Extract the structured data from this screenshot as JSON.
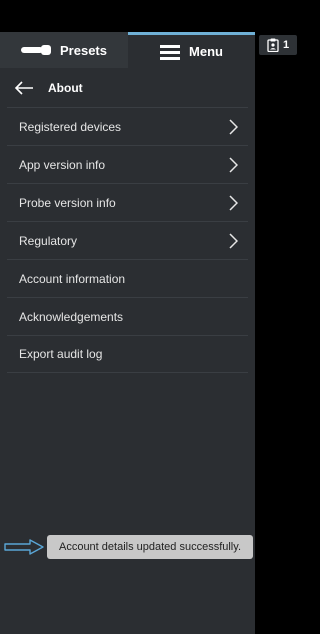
{
  "tabs": {
    "presets_label": "Presets",
    "menu_label": "Menu"
  },
  "badge": {
    "count": "1",
    "icon": "clipboard-user-icon"
  },
  "panel": {
    "title": "About",
    "items": [
      {
        "label": "Registered devices",
        "has_chevron": true
      },
      {
        "label": "App version info",
        "has_chevron": true
      },
      {
        "label": "Probe version info",
        "has_chevron": true
      },
      {
        "label": "Regulatory",
        "has_chevron": true
      },
      {
        "label": "Account information",
        "has_chevron": false
      },
      {
        "label": "Acknowledgements",
        "has_chevron": false
      },
      {
        "label": "Export audit log",
        "has_chevron": false
      }
    ]
  },
  "toast": {
    "message": "Account details updated successfully."
  },
  "colors": {
    "panel_bg": "#2b2e32",
    "active_tab_accent": "#6fb0d6",
    "toast_bg": "#c8c8c8",
    "arrow_color": "#5aa6d6"
  }
}
